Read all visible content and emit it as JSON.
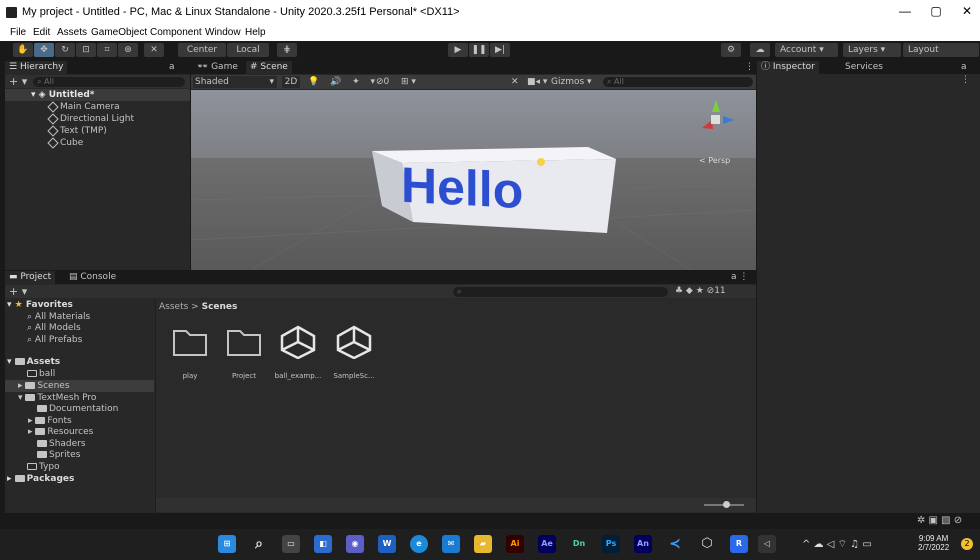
{
  "window": {
    "title": "My project - Untitled - PC, Mac & Linux Standalone - Unity 2020.3.25f1 Personal* <DX11>",
    "minimize": "—",
    "maximize": "▢",
    "close": "✕"
  },
  "menu": [
    "File",
    "Edit",
    "Assets",
    "GameObject",
    "Component",
    "Window",
    "Help"
  ],
  "toolbar": {
    "center": "Center",
    "local": "Local",
    "account": "Account",
    "layers": "Layers",
    "layout": "Layout"
  },
  "hierarchy": {
    "tab": "Hierarchy",
    "search": "All",
    "scene": "Untitled*",
    "items": [
      "Main Camera",
      "Directional Light",
      "Text (TMP)",
      "Cube"
    ]
  },
  "sceneview": {
    "tab_game": "Game",
    "tab_scene": "Scene",
    "shading": "Shaded",
    "mode2d": "2D",
    "gizmos": "Gizmos",
    "search": "All",
    "hidden_count": "0",
    "persp": "< Persp",
    "cube_text": "Hello"
  },
  "inspector": {
    "tab": "Inspector",
    "services": "Services"
  },
  "project": {
    "tab": "Project",
    "console": "Console",
    "favorites_title": "Favorites",
    "favorites": [
      "All Materials",
      "All Models",
      "All Prefabs"
    ],
    "assets_title": "Assets",
    "tree": {
      "ball": "ball",
      "scenes": "Scenes",
      "textmesh": "TextMesh Pro",
      "documentation": "Documentation",
      "fonts": "Fonts",
      "resources": "Resources",
      "shaders": "Shaders",
      "sprites": "Sprites",
      "typo": "Typo"
    },
    "packages": "Packages",
    "breadcrumb_root": "Assets",
    "breadcrumb_sep": ">",
    "breadcrumb_leaf": "Scenes",
    "hidden_count": "11",
    "grid": [
      "play",
      "Project",
      "ball_examp...",
      "SampleSc..."
    ]
  },
  "taskbar": {
    "time": "9:09 AM",
    "date": "2/7/2022",
    "badge": "2",
    "apps": [
      "Ai",
      "Ae",
      "Dn",
      "Ps",
      "An"
    ]
  },
  "colors": {
    "bg": "#191919",
    "panel": "#282828",
    "accent": "#2c5d87",
    "scene_sky": "#8a8f97",
    "ground": "#5f5f5f",
    "hello": "#2c4fd1"
  }
}
